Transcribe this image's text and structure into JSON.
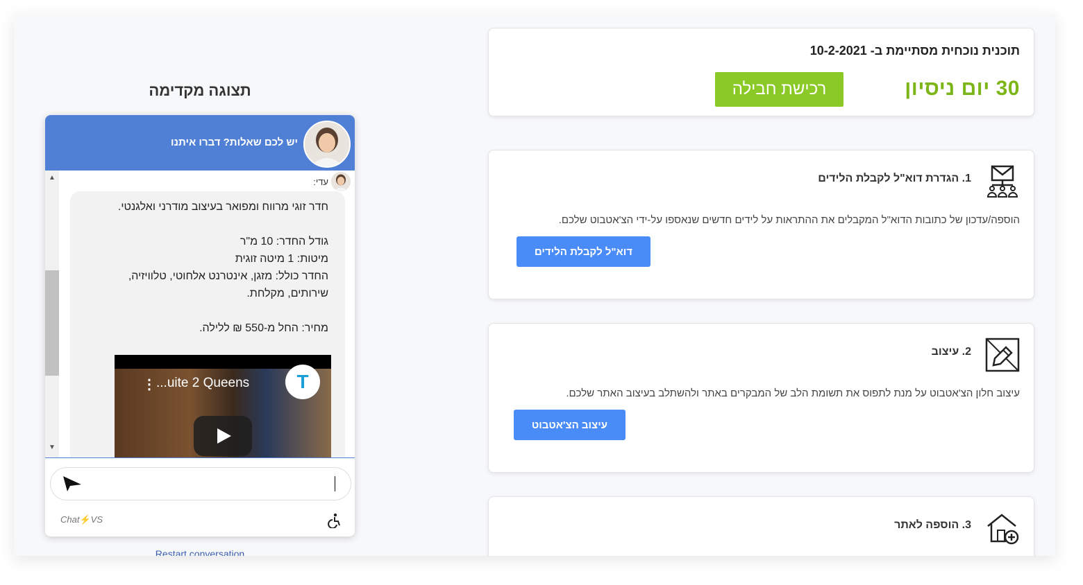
{
  "plan": {
    "title": "תוכנית נוכחית מסתיימת ב- 10-2-2021",
    "trial": "30 יום ניסיון",
    "buy_button": "רכישת חבילה"
  },
  "steps": [
    {
      "title": "1. הגדרת דוא\"ל לקבלת הלידים",
      "desc": "הוספה/עדכון של כתובות הדוא\"ל המקבלים את ההתראות על לידים חדשים שנאספו על-ידי הצ'אטבוט שלכם.",
      "button": "דוא\"ל לקבלת הלידים",
      "icon": "email-network-icon"
    },
    {
      "title": "2. עיצוב",
      "desc": "עיצוב חלון הצ'אטבוט על מנת לתפוס את תשומת הלב של המבקרים באתר ולהשתלב בעיצוב האתר שלכם.",
      "button": "עיצוב הצ'אטבוט",
      "icon": "design-pencil-icon"
    },
    {
      "title": "3. הוספה לאתר",
      "icon": "house-add-icon"
    }
  ],
  "preview": {
    "title": "תצוגה מקדימה",
    "header_text": "יש לכם שאלות? דברו איתנו",
    "sender": "עדי:",
    "message_lines": [
      "חדר זוגי מרווח ומפואר בעיצוב מודרני ואלגנטי.",
      "גודל החדר: 10 מ\"ר",
      "מיטות: 1 מיטה זוגית",
      "החדר כולל: מזגן, אינטרנט אלחוטי, טלוויזיה,",
      "שירותים, מקלחת.",
      "מחיר: החל מ-550 ₪ ללילה."
    ],
    "video_title": "...uite 2 Queens",
    "brand_prefix": "Chat",
    "brand_suffix": "VS",
    "restart": "Restart conversation"
  },
  "colors": {
    "accent_green": "#8bc926",
    "trial_green": "#7cb518",
    "button_blue": "#4a8cf7",
    "chat_header": "#4f80d6"
  }
}
